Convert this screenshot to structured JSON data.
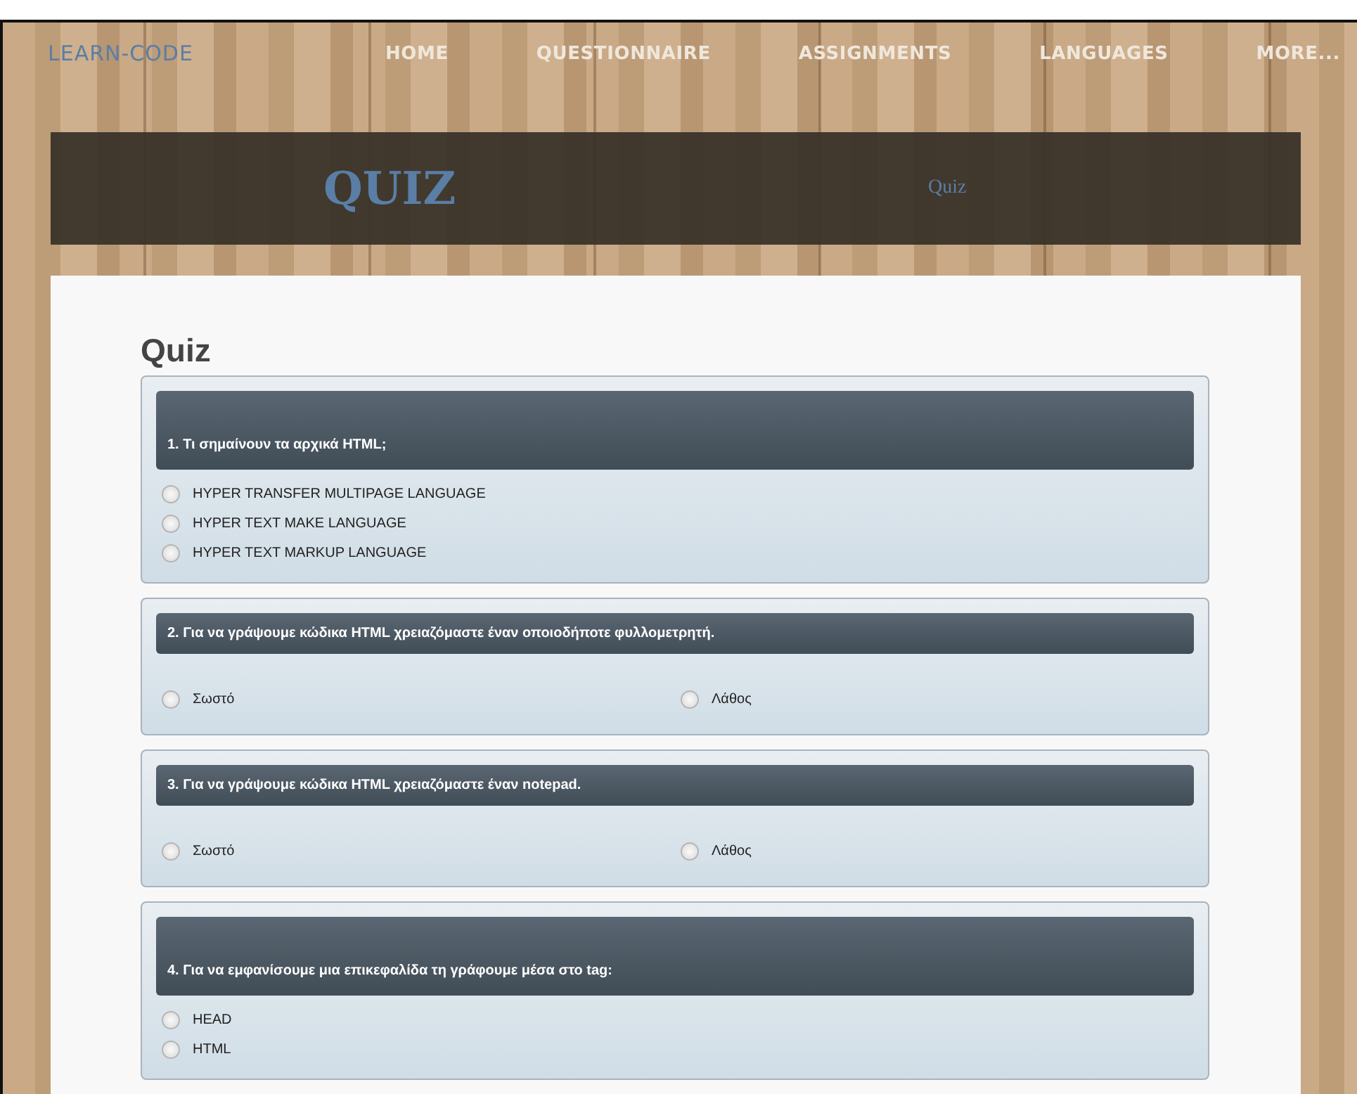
{
  "brand": "LEARN-CODE",
  "nav": [
    "HOME",
    "QUESTIONNAIRE",
    "ASSIGNMENTS",
    "LANGUAGES",
    "MORE..."
  ],
  "banner": {
    "title": "QUIZ",
    "breadcrumb": "Quiz"
  },
  "heading": "Quiz",
  "questions": [
    {
      "kind": "list",
      "text": "1. Τι σημαίνουν τα αρχικά HTML;",
      "options": [
        {
          "label": "HYPER TRANSFER MULTIPAGE LANGUAGE",
          "selected": false
        },
        {
          "label": "HYPER TEXT MAKE LANGUAGE",
          "selected": false
        },
        {
          "label": "HYPER TEXT MARKUP LANGUAGE",
          "selected": false
        }
      ]
    },
    {
      "kind": "inline",
      "text": "2. Για να γράψουμε κώδικα HTML χρειαζόμαστε έναν οποιοδήποτε φυλλομετρητή.",
      "options": [
        {
          "label": "Σωστό",
          "selected": false
        },
        {
          "label": "Λάθος",
          "selected": false
        }
      ]
    },
    {
      "kind": "inline",
      "text": "3. Για να γράψουμε κώδικα HTML χρειαζόμαστε έναν notepad.",
      "options": [
        {
          "label": "Σωστό",
          "selected": false
        },
        {
          "label": "Λάθος",
          "selected": false
        }
      ]
    },
    {
      "kind": "list",
      "text": "4. Για να εμφανίσουμε μια επικεφαλίδα τη γράφουμε μέσα στο tag:",
      "options": [
        {
          "label": "HEAD",
          "selected": false
        },
        {
          "label": "HTML",
          "selected": false
        }
      ]
    }
  ]
}
